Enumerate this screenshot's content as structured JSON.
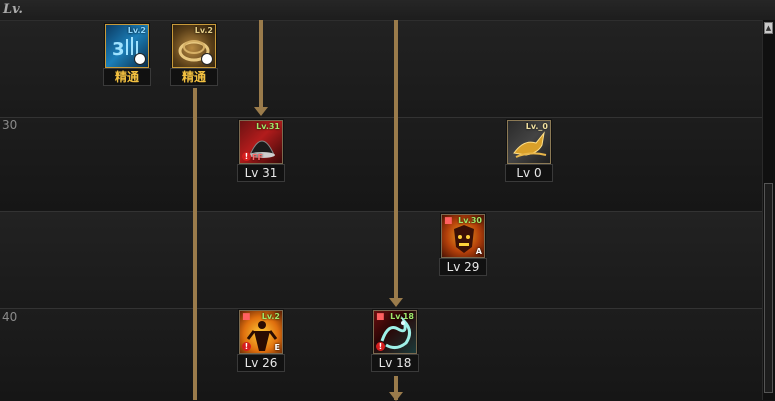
{
  "header": {
    "lv_label": "Lv."
  },
  "rows": [
    {
      "level_label": "30"
    },
    {
      "level_label": "40"
    }
  ],
  "mastery": [
    {
      "label": "精通",
      "icon": "circuit-skill-icon",
      "tag": "Lv.2"
    },
    {
      "label": "精通",
      "icon": "scroll-skill-icon",
      "tag": "Lv.2"
    }
  ],
  "skills": [
    {
      "label": "Lv 31",
      "tag": "Lv.31",
      "icon": "dark-cloak-skill-icon",
      "corner": "FF"
    },
    {
      "label": "Lv 0",
      "tag": "Lv._0",
      "icon": "golden-steed-skill-icon",
      "corner": ""
    },
    {
      "label": "Lv 29",
      "tag": "Lv.30",
      "icon": "demon-face-skill-icon",
      "corner": "A"
    },
    {
      "label": "Lv 26",
      "tag": "Lv.2",
      "icon": "flame-figure-skill-icon",
      "corner": "E"
    },
    {
      "label": "Lv 18",
      "tag": "Lv.18",
      "icon": "spirit-dragon-skill-icon",
      "corner": ""
    }
  ],
  "colors": {
    "arrow": "#9a7b4b",
    "mastery_text": "#f2c040",
    "level_tag": "#9fe86a"
  }
}
